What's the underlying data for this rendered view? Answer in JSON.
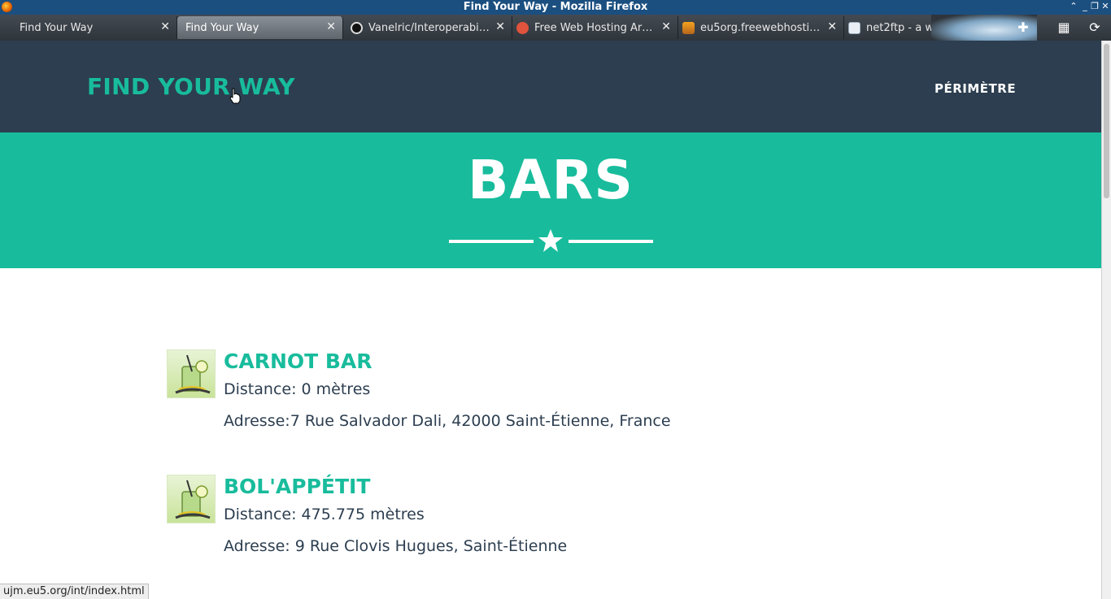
{
  "window": {
    "title": "Find Your Way - Mozilla Firefox"
  },
  "tabs": [
    {
      "label": "Find Your Way",
      "active": false
    },
    {
      "label": "Find Your Way",
      "active": true
    },
    {
      "label": "Vanelric/Interoperabil…",
      "icon": "github-icon"
    },
    {
      "label": "Free Web Hosting Ar…",
      "icon": "webhost-icon"
    },
    {
      "label": "eu5org.freewebhosti…",
      "icon": "phpmyadmin-icon"
    },
    {
      "label": "net2ftp - a web base…",
      "icon": "net2ftp-icon"
    }
  ],
  "site": {
    "brand": "FIND YOUR WAY",
    "nav_link": "PÉRIMÈTRE"
  },
  "hero": {
    "title": "BARS"
  },
  "bars": [
    {
      "name": "CARNOT BAR",
      "distance": "Distance: 0 mètres",
      "address": "Adresse:7 Rue Salvador Dali, 42000 Saint-Étienne, France"
    },
    {
      "name": "BOL'APPÉTIT",
      "distance": "Distance: 475.775 mètres",
      "address": "Adresse: 9 Rue Clovis Hugues, Saint-Étienne"
    }
  ],
  "status": {
    "url": "ujm.eu5.org/int/index.html"
  },
  "colors": {
    "primary": "#2c3e50",
    "accent": "#18bc9c",
    "titlebar": "#1b4f80"
  }
}
